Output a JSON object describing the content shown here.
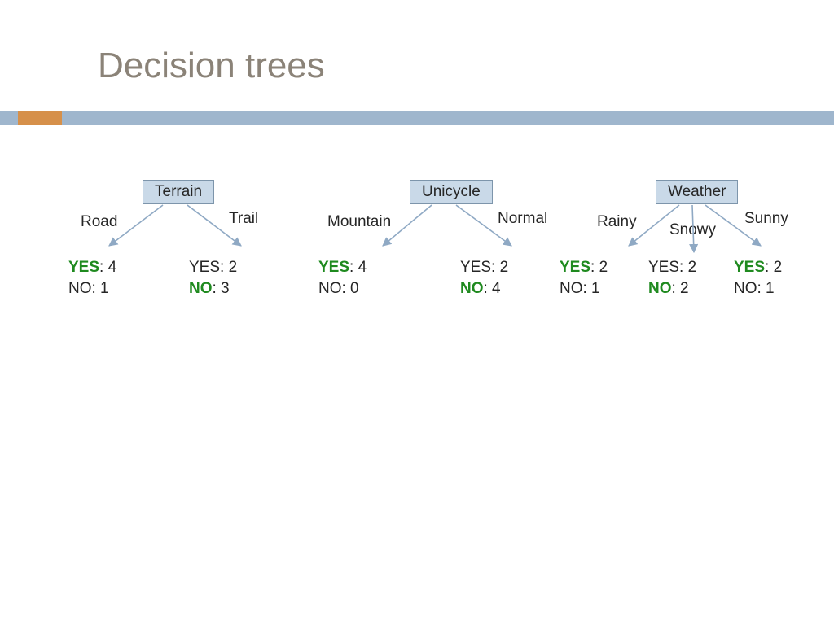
{
  "title": "Decision trees",
  "trees": [
    {
      "name": "Terrain",
      "branches": [
        {
          "label": "Road",
          "yes": 4,
          "no": 1,
          "emphasis": "yes"
        },
        {
          "label": "Trail",
          "yes": 2,
          "no": 3,
          "emphasis": "no"
        }
      ]
    },
    {
      "name": "Unicycle",
      "branches": [
        {
          "label": "Mountain",
          "yes": 4,
          "no": 0,
          "emphasis": "yes"
        },
        {
          "label": "Normal",
          "yes": 2,
          "no": 4,
          "emphasis": "no"
        }
      ]
    },
    {
      "name": "Weather",
      "branches": [
        {
          "label": "Rainy",
          "yes": 2,
          "no": 1,
          "emphasis": "yes"
        },
        {
          "label": "Snowy",
          "yes": 2,
          "no": 2,
          "emphasis": "no"
        },
        {
          "label": "Sunny",
          "yes": 2,
          "no": 1,
          "emphasis": "yes"
        }
      ]
    }
  ],
  "labels": {
    "yes": "YES",
    "no": "NO"
  }
}
